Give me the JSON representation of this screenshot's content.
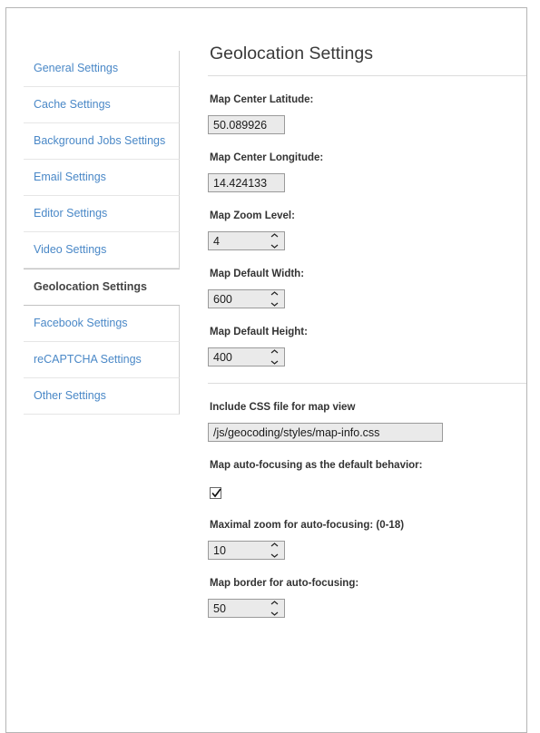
{
  "sidebar": {
    "items": [
      {
        "label": "General Settings",
        "active": false
      },
      {
        "label": "Cache Settings",
        "active": false
      },
      {
        "label": "Background Jobs Settings",
        "active": false
      },
      {
        "label": "Email Settings",
        "active": false
      },
      {
        "label": "Editor Settings",
        "active": false
      },
      {
        "label": "Video Settings",
        "active": false
      },
      {
        "label": "Geolocation Settings",
        "active": true
      },
      {
        "label": "Facebook Settings",
        "active": false
      },
      {
        "label": "reCAPTCHA Settings",
        "active": false
      },
      {
        "label": "Other Settings",
        "active": false
      }
    ]
  },
  "main": {
    "title": "Geolocation Settings",
    "fields": {
      "latitude": {
        "label": "Map Center Latitude:",
        "value": "50.089926"
      },
      "longitude": {
        "label": "Map Center Longitude:",
        "value": "14.424133"
      },
      "zoom_level": {
        "label": "Map Zoom Level:",
        "value": "4"
      },
      "width": {
        "label": "Map Default Width:",
        "value": "600"
      },
      "height": {
        "label": "Map Default Height:",
        "value": "400"
      },
      "css_file": {
        "label": "Include CSS file for map view",
        "value": "/js/geocoding/styles/map-info.css"
      },
      "auto_focus": {
        "label": "Map auto-focusing as the default behavior:",
        "checked": true
      },
      "max_zoom": {
        "label": "Maximal zoom for auto-focusing: (0-18)",
        "value": "10"
      },
      "border": {
        "label": "Map border for auto-focusing:",
        "value": "50"
      }
    }
  },
  "colors": {
    "link": "#4a88c7",
    "active_text": "#444444",
    "input_bg": "#eaeaea",
    "input_border": "#9a9a9a",
    "frame_border": "#b5b5b5"
  }
}
